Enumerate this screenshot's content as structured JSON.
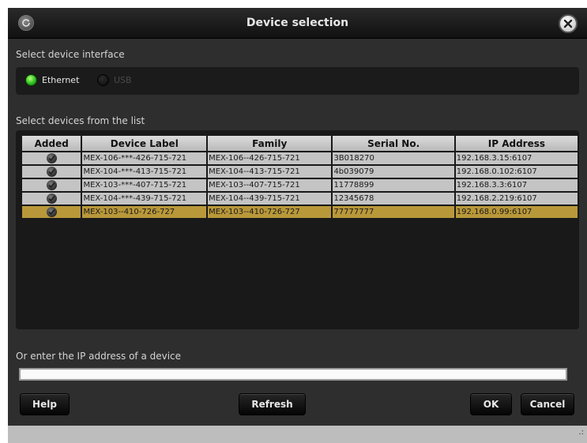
{
  "window": {
    "title": "Device selection"
  },
  "interface": {
    "label": "Select device interface",
    "options": [
      {
        "label": "Ethernet",
        "selected": true
      },
      {
        "label": "USB",
        "selected": false
      }
    ]
  },
  "devices": {
    "label": "Select devices from the list",
    "columns": [
      "Added",
      "Device Label",
      "Family",
      "Serial No.",
      "IP Address"
    ],
    "rows": [
      {
        "added": true,
        "device_label": "MEX-106-***-426-715-721",
        "family": "MEX-106--426-715-721",
        "serial": "3B018270",
        "ip": "192.168.3.15:6107",
        "selected": false
      },
      {
        "added": true,
        "device_label": "MEX-104-***-413-715-721",
        "family": "MEX-104--413-715-721",
        "serial": "4b039079",
        "ip": "192.168.0.102:6107",
        "selected": false
      },
      {
        "added": true,
        "device_label": "MEX-103-***-407-715-721",
        "family": "MEX-103--407-715-721",
        "serial": "11778899",
        "ip": "192.168.3.3:6107",
        "selected": false
      },
      {
        "added": true,
        "device_label": "MEX-104-***-439-715-721",
        "family": "MEX-104--439-715-721",
        "serial": "12345678",
        "ip": "192.168.2.219:6107",
        "selected": false
      },
      {
        "added": true,
        "device_label": "MEX-103--410-726-727",
        "family": "MEX-103--410-726-727",
        "serial": "77777777",
        "ip": "192.168.0.99:6107",
        "selected": true
      }
    ]
  },
  "ip_entry": {
    "label": "Or enter the IP address of a device",
    "value": ""
  },
  "buttons": {
    "help": "Help",
    "refresh": "Refresh",
    "ok": "OK",
    "cancel": "Cancel"
  },
  "statusbar": {
    "grip": ".:"
  },
  "icons": {
    "titlebar_left": "refresh-icon",
    "titlebar_right": "close-icon",
    "row_added": "check-icon"
  },
  "colors": {
    "selected_row": "#b9983a",
    "radio_on": "#2bbf1e"
  }
}
